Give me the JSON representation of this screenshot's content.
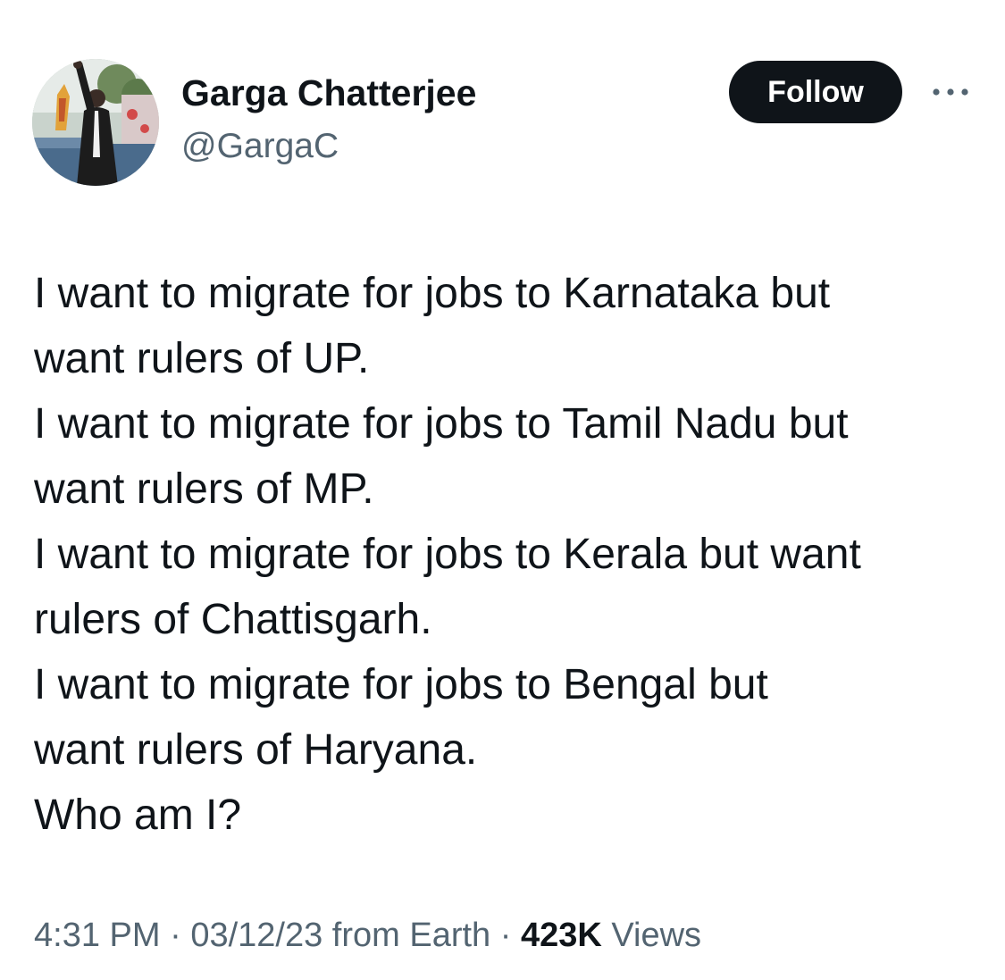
{
  "author": {
    "display_name": "Garga Chatterjee",
    "handle": "@GargaC",
    "avatar_icon": "profile-photo"
  },
  "header": {
    "follow_label": "Follow",
    "more_icon": "more-horizontal-icon"
  },
  "tweet": {
    "lines": [
      "I want to migrate for jobs to Karnataka but",
      "want rulers of UP.",
      "I want to migrate for jobs to Tamil Nadu but",
      "want rulers of MP.",
      "I want to migrate for jobs to Kerala but want",
      "rulers of Chattisgarh.",
      "I want to migrate for jobs to Bengal but",
      "want rulers of Haryana.",
      "Who am I?"
    ]
  },
  "meta": {
    "time": "4:31 PM",
    "separator": "·",
    "date": "03/12/23",
    "source": "from Earth",
    "views_count": "423K",
    "views_label": "Views"
  },
  "colors": {
    "text_primary": "#0f1419",
    "text_secondary": "#536471",
    "follow_bg": "#0f1419",
    "follow_text": "#ffffff",
    "background": "#ffffff"
  }
}
